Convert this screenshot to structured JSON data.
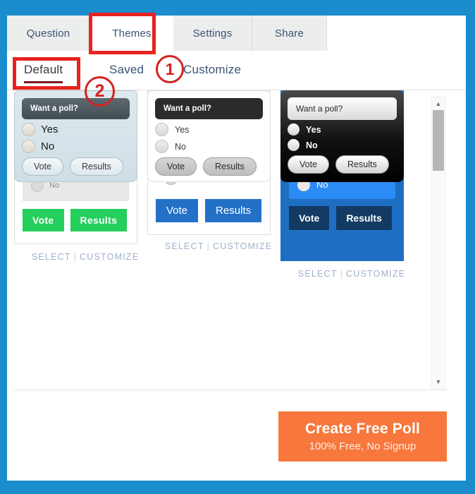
{
  "theme_colors": {
    "page_background": "#1b8ccc",
    "panel_background": "#ffffff",
    "tabstrip_background": "#eceded",
    "tab_text": "#3b5272",
    "active_subtab_underline": "#7d1720",
    "caption_text": "#9fb0cc",
    "cta_background": "#f7773c",
    "annotation_red": "#e8221e"
  },
  "tabs": [
    {
      "label": "Question",
      "active": false
    },
    {
      "label": "Themes",
      "active": true
    },
    {
      "label": "Settings",
      "active": false
    },
    {
      "label": "Share",
      "active": false
    }
  ],
  "subtabs": [
    {
      "label": "Default",
      "active": true
    },
    {
      "label": "Saved",
      "active": false
    },
    {
      "label": "Customize",
      "active": false
    }
  ],
  "caption": {
    "select": "SELECT",
    "separator": "|",
    "customize": "CUSTOMIZE"
  },
  "poll": {
    "question": "Want a poll?",
    "option_yes": "Yes",
    "option_no": "No",
    "vote_label": "Vote",
    "results_label": "Results"
  },
  "themes": [
    {
      "id": "theme-dark-green",
      "question": "Want a poll?",
      "yes": "Yes",
      "no": "No",
      "vote": "Vote",
      "results": "Results",
      "header_color": "#2e2e2e",
      "button_color": "#24cf5b"
    },
    {
      "id": "theme-navy-blue",
      "question": "Want a poll?",
      "yes": "Yes",
      "no": "No",
      "vote": "Vote",
      "results": "Results",
      "header_color": "#123a63",
      "button_color": "#2271c6"
    },
    {
      "id": "theme-full-blue",
      "question": "Want a poll?",
      "yes": "Yes",
      "no": "No",
      "vote": "Vote",
      "results": "Results",
      "header_color": "#123a63",
      "background_color": "#1e6fc4",
      "option_color": "#2b8cf5"
    },
    {
      "id": "theme-light-steel",
      "question": "Want a poll?",
      "yes": "Yes",
      "no": "No",
      "vote": "Vote",
      "results": "Results",
      "header_color": "#4c585e",
      "background_color": "#d7e3ea"
    },
    {
      "id": "theme-white-grey",
      "question": "Want a poll?",
      "yes": "Yes",
      "no": "No",
      "vote": "Vote",
      "results": "Results",
      "header_color": "#2b2b2b",
      "background_color": "#ffffff"
    },
    {
      "id": "theme-black-glossy",
      "question": "Want a poll?",
      "yes": "Yes",
      "no": "No",
      "vote": "Vote",
      "results": "Results",
      "header_color": "#ffffff",
      "background_color": "#000000"
    }
  ],
  "scrollbar": {
    "up_arrow": "▲",
    "down_arrow": "▼"
  },
  "cta": {
    "title": "Create Free Poll",
    "subtitle": "100% Free, No Signup"
  },
  "annotations": {
    "marker_one": "1",
    "marker_two": "2"
  }
}
